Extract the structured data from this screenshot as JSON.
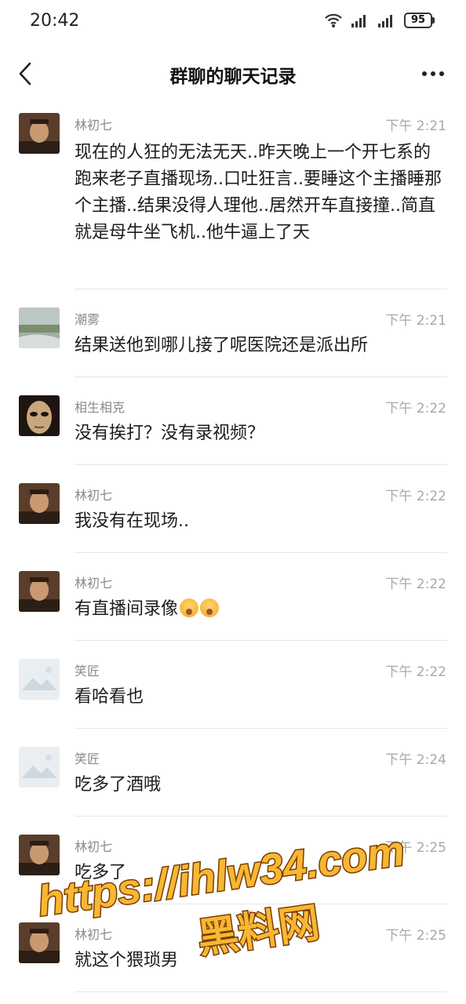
{
  "status_bar": {
    "time": "20:42",
    "battery": "95"
  },
  "header": {
    "title": "群聊的聊天记录"
  },
  "messages": [
    {
      "sender": "林初七",
      "time": "下午 2:21",
      "text": "现在的人狂的无法无天..昨天晚上一个开七系的跑来老子直播现场..口吐狂言..要睡这个主播睡那个主播..结果没得人理他..居然开车直接撞..简直就是母牛坐飞机..他牛逼上了天",
      "avatar": "man"
    },
    {
      "sender": "潮雾",
      "time": "下午 2:21",
      "text": "结果送他到哪儿接了呢医院还是派出所",
      "avatar": "landscape"
    },
    {
      "sender": "相生相克",
      "time": "下午 2:22",
      "text": "没有挨打？没有录视频？",
      "avatar": "mask"
    },
    {
      "sender": "林初七",
      "time": "下午 2:22",
      "text": "我没有在现场..",
      "avatar": "man"
    },
    {
      "sender": "林初七",
      "time": "下午 2:22",
      "text": "有直播间录像",
      "avatar": "man"
    },
    {
      "sender": "笑匠",
      "time": "下午 2:22",
      "text": "看哈看也",
      "avatar": "placeholder"
    },
    {
      "sender": "笑匠",
      "time": "下午 2:24",
      "text": "吃多了酒哦",
      "avatar": "placeholder"
    },
    {
      "sender": "林初七",
      "time": "下午 2:25",
      "text": "吃多了",
      "avatar": "man"
    },
    {
      "sender": "林初七",
      "time": "下午 2:25",
      "text": "就这个猥琐男",
      "avatar": "man"
    }
  ],
  "watermark": {
    "line1": "https://ihlw34.com",
    "line2": "黑料网"
  }
}
